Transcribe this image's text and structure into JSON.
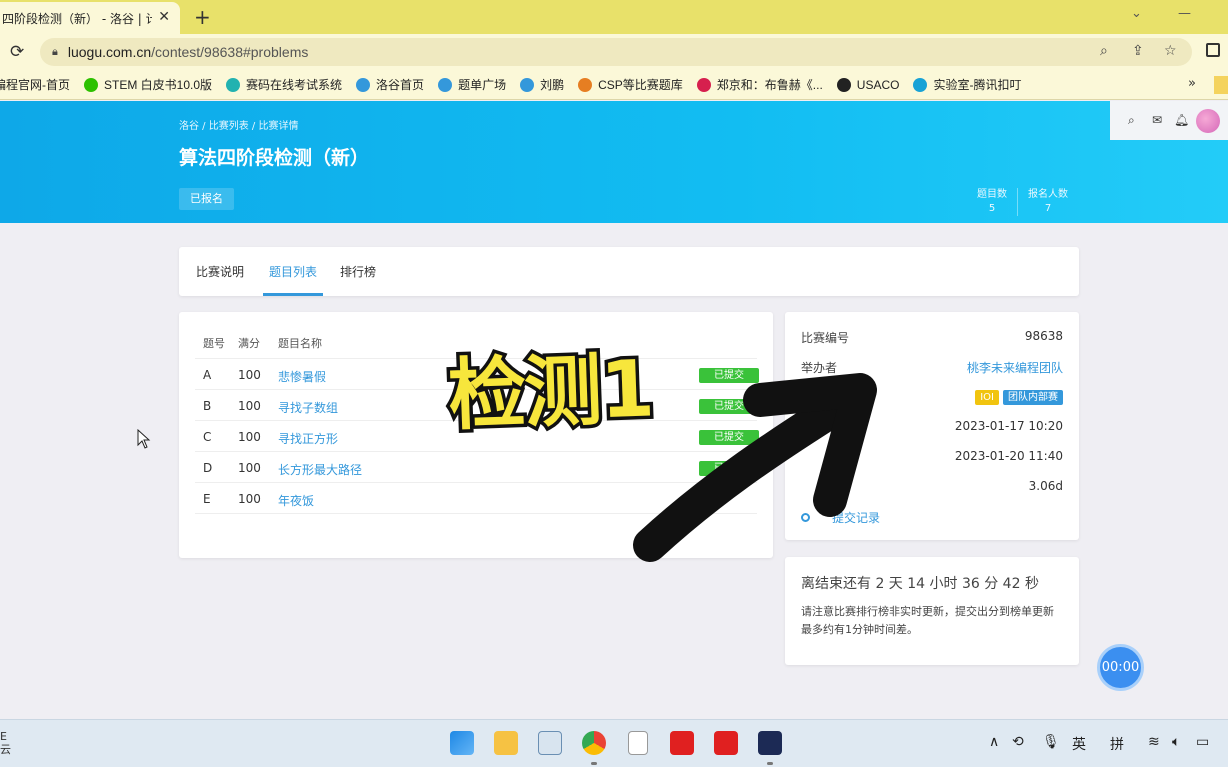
{
  "browser": {
    "tab_title": "四阶段检测（新） - 洛谷 | 计",
    "close_glyph": "✕",
    "new_tab_glyph": "+",
    "url_host": "luogu.com.cn",
    "url_path": "/contest/98638#problems",
    "bookmarks": [
      {
        "label": "编程官网-首页",
        "icon": "blank",
        "color": "#fbf8d8"
      },
      {
        "label": "STEM 白皮书10.0版",
        "icon": "wechat-icon",
        "color": "#2dc100"
      },
      {
        "label": "赛码在线考试系统",
        "icon": "sai-icon",
        "color": "#22b2b0"
      },
      {
        "label": "洛谷首页",
        "icon": "luogu-icon",
        "color": "#3498db"
      },
      {
        "label": "题单广场",
        "icon": "luogu-icon",
        "color": "#3498db"
      },
      {
        "label": "刘鹏",
        "icon": "luogu-icon",
        "color": "#3498db"
      },
      {
        "label": "CSP等比赛题库",
        "icon": "luogu-icon",
        "color": "#e67e22"
      },
      {
        "label": "郑京和：布鲁赫《...",
        "icon": "red-icon",
        "color": "#d6204e"
      },
      {
        "label": "USACO",
        "icon": "globe-icon",
        "color": "#222"
      },
      {
        "label": "实验室-腾讯扣叮",
        "icon": "coding-icon",
        "color": "#18a2d6"
      }
    ],
    "more_glyph": "»"
  },
  "header": {
    "breadcrumb": "洛谷 / 比赛列表 / 比赛详情",
    "title": "算法四阶段检测（新）",
    "register_label": "已报名",
    "stats": [
      {
        "label": "题目数",
        "value": "5"
      },
      {
        "label": "报名人数",
        "value": "7"
      }
    ]
  },
  "tabs": [
    "比赛说明",
    "题目列表",
    "排行榜"
  ],
  "problems": {
    "headers": [
      "题号",
      "满分",
      "题目名称"
    ],
    "rows": [
      {
        "id": "A",
        "score": "100",
        "name": "悲惨暑假",
        "status": "已提交"
      },
      {
        "id": "B",
        "score": "100",
        "name": "寻找子数组",
        "status": "已提交"
      },
      {
        "id": "C",
        "score": "100",
        "name": "寻找正方形",
        "status": "已提交"
      },
      {
        "id": "D",
        "score": "100",
        "name": "长方形最大路径",
        "status": "已提交"
      },
      {
        "id": "E",
        "score": "100",
        "name": "年夜饭",
        "status": ""
      }
    ]
  },
  "info": {
    "id_label": "比赛编号",
    "id_value": "98638",
    "host_label": "举办者",
    "host_value": "桃李未来编程团队",
    "tag_ioi": "IOI",
    "tag_team": "团队内部赛",
    "start": "2023-01-17 10:20",
    "end": "2023-01-20 11:40",
    "duration": "3.06d",
    "records_link": "提交记录"
  },
  "countdown": {
    "title": "离结束还有 2 天 14 小时 36 分 42 秒",
    "note": "请注意比赛排行榜非实时更新，提交出分到榜单更新最多约有1分钟时间差。"
  },
  "timer": "00:00",
  "overlay": "检测1",
  "taskbar": {
    "left_text": "E\n云",
    "ime_lang": "英",
    "ime_mode": "拼"
  },
  "colors": {
    "accent": "#3498db",
    "submitted": "#3ac23a",
    "banner": "#12bdf2"
  }
}
